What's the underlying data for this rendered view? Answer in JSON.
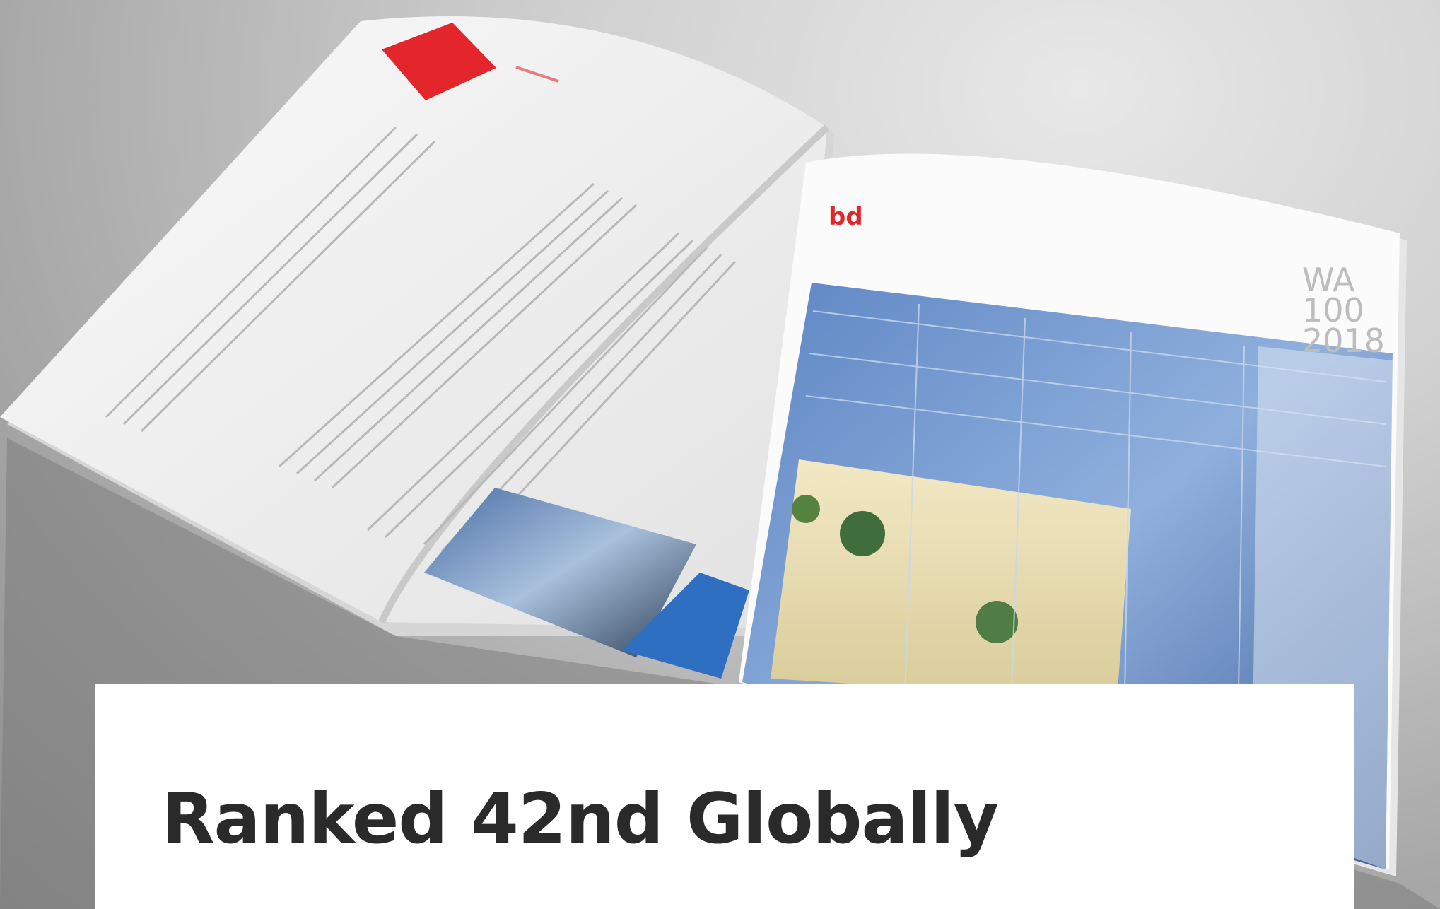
{
  "hero": {
    "magazine_logo_text": "bd",
    "cover_text": [
      "WA",
      "100",
      "2018"
    ]
  },
  "headline": "Ranked 42nd Globally"
}
